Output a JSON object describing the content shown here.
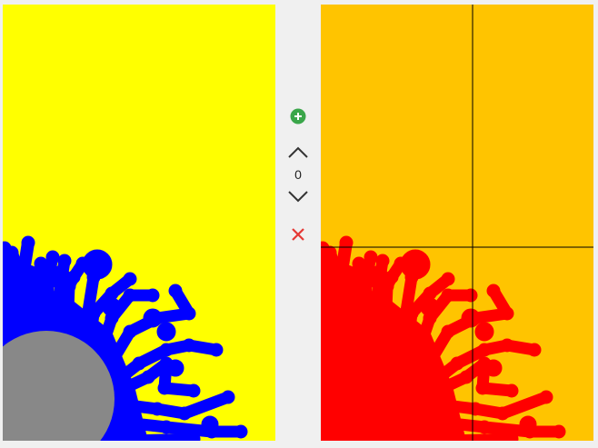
{
  "colors": {
    "window_bg": "#f0f0f0",
    "left_background": "#ffff00",
    "left_growth": "#0000ff",
    "seed": "#888888",
    "right_background": "#ffc400",
    "right_growth": "#ff0000",
    "crosshair": "#000000",
    "add_icon": "#3aa64a",
    "delete_icon": "#e53935",
    "chevron": "#333333"
  },
  "toolbar": {
    "add_icon": "plus-circle-icon",
    "up_icon": "chevron-up-icon",
    "counter_value": "0",
    "down_icon": "chevron-down-icon",
    "delete_icon": "close-icon"
  }
}
